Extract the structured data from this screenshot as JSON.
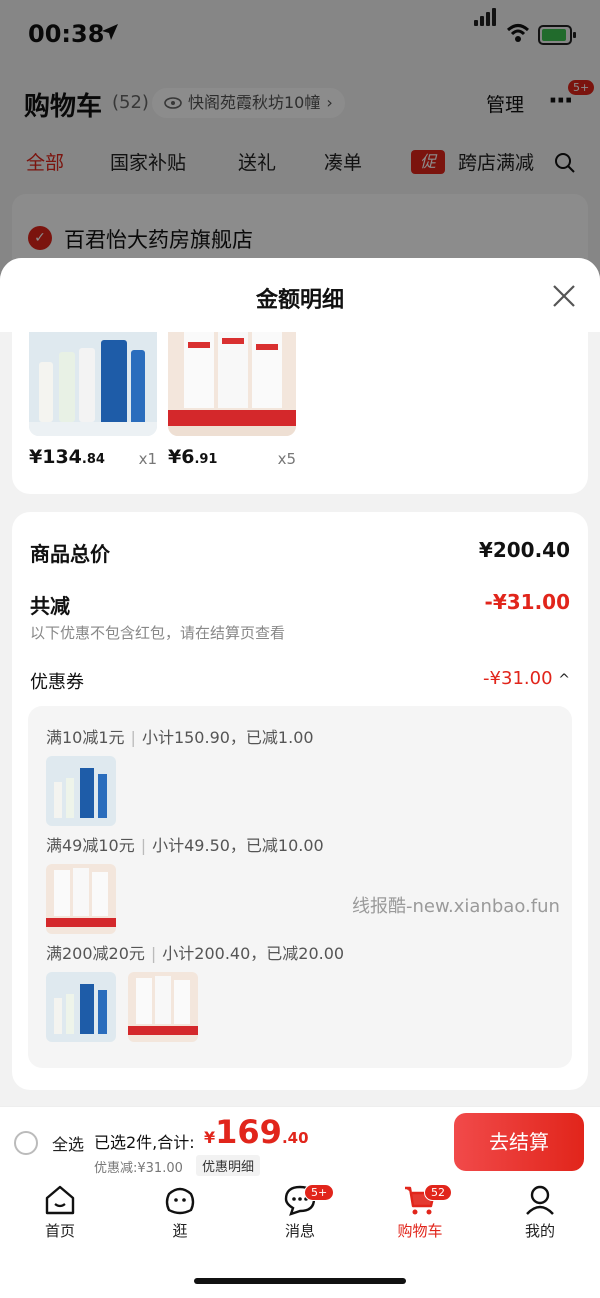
{
  "status_bar": {
    "time": "00:38"
  },
  "header": {
    "title": "购物车",
    "count": "(52)",
    "address": "快阁苑霞秋坊10幢",
    "manage_label": "管理",
    "more_badge": "5+"
  },
  "tabs": [
    "全部",
    "国家补贴",
    "送礼",
    "凑单",
    "跨店满减"
  ],
  "promo_tag": "促",
  "store": {
    "name": "百君怡大药房旗舰店"
  },
  "sheet": {
    "title": "金额明细",
    "products": [
      {
        "price_int": "¥134",
        "price_dec": ".84",
        "qty": "x1"
      },
      {
        "price_int": "¥6",
        "price_dec": ".91",
        "qty": "x5"
      }
    ],
    "total_label": "商品总价",
    "total_value": "¥200.40",
    "reduce_label": "共减",
    "reduce_value": "-¥31.00",
    "note": "以下优惠不包含红包，请在结算页查看",
    "coupon_label": "优惠券",
    "coupon_value": "-¥31.00",
    "coupon_lines": [
      {
        "rule": "满10减1元",
        "detail": "小计150.90，已减1.00"
      },
      {
        "rule": "满49减10元",
        "detail": "小计49.50，已减10.00"
      },
      {
        "rule": "满200减20元",
        "detail": "小计200.40，已减20.00"
      }
    ]
  },
  "watermark": "线报酷-new.xianbao.fun",
  "checkout": {
    "select_all": "全选",
    "selected_text": "已选2件,合计:",
    "total_currency": "¥",
    "total_int": "169",
    "total_dec": ".40",
    "discount_text": "优惠减:¥31.00",
    "detail_button": "优惠明细",
    "pay_button": "去结算"
  },
  "tabbar": [
    {
      "label": "首页"
    },
    {
      "label": "逛"
    },
    {
      "label": "消息",
      "badge": "5+"
    },
    {
      "label": "购物车",
      "badge": "52"
    },
    {
      "label": "我的"
    }
  ],
  "colors": {
    "accent": "#e1251b"
  }
}
